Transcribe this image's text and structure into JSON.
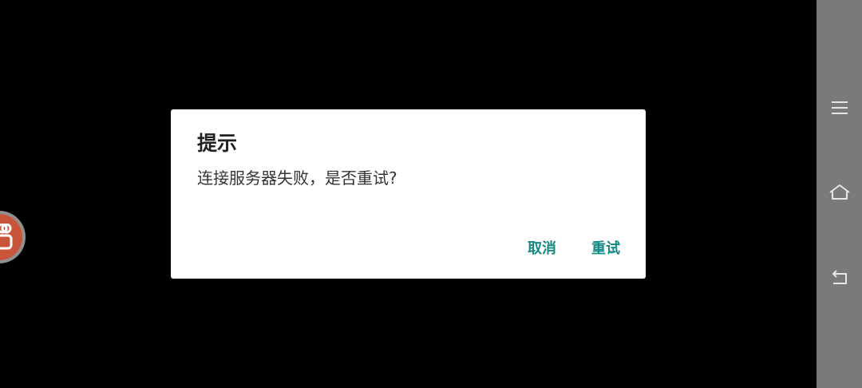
{
  "dialog": {
    "title": "提示",
    "message": "连接服务器失败，是否重试?",
    "cancel_label": "取消",
    "retry_label": "重试"
  },
  "nav_bar": {
    "items": [
      {
        "icon": "menu-icon"
      },
      {
        "icon": "home-icon"
      },
      {
        "icon": "back-icon"
      }
    ]
  },
  "floating_button": {
    "icon": "kuaishou-logo-icon"
  },
  "colors": {
    "background": "#000000",
    "dialog_bg": "#ffffff",
    "accent": "#138a82",
    "nav_bar_bg": "#7a7a7a",
    "float_ball": "#c8553a"
  }
}
